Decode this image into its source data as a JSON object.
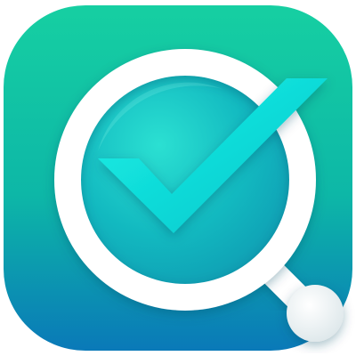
{
  "icon": {
    "name": "search-check-icon",
    "colors": {
      "background_top": "#16CFA2",
      "background_mid": "#0DB7A7",
      "background_bottom": "#0A79B8",
      "lens_glass_light": "#2BE0D2",
      "lens_glass_dark": "#0F9AB2",
      "ring": "#FFFFFF",
      "checkmark_light": "#16F2E6",
      "checkmark_dark": "#0BC4CB",
      "handle_knob": "#F2F2F2"
    }
  }
}
